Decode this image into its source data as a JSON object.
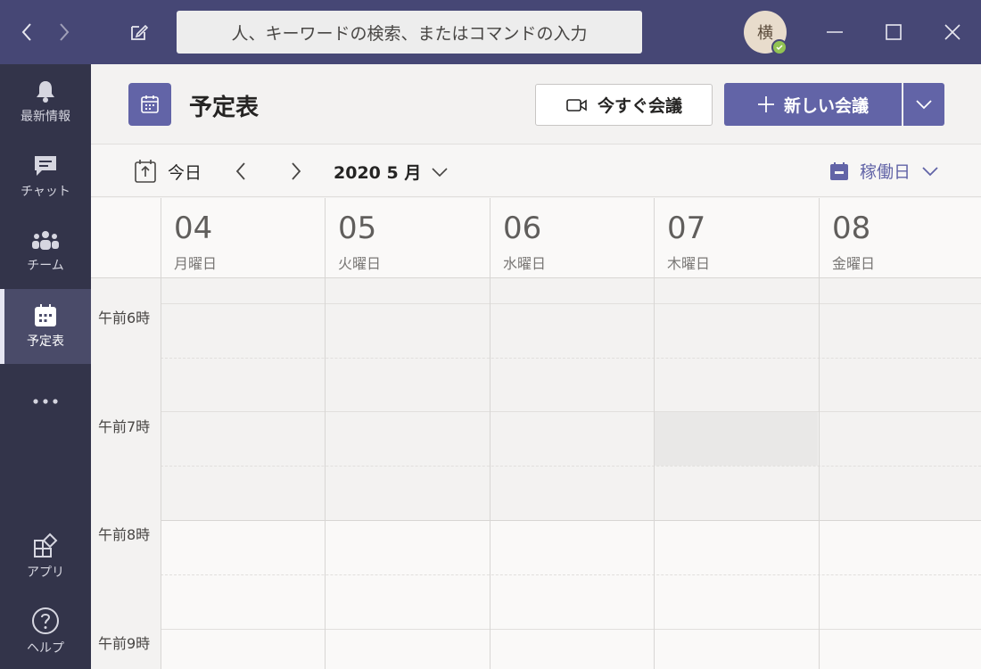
{
  "titlebar": {
    "search_placeholder": "人、キーワードの検索、またはコマンドの入力",
    "avatar_initial": "横",
    "bg_color": "#464775"
  },
  "rail": {
    "items": [
      {
        "label": "最新情報",
        "icon": "bell-icon"
      },
      {
        "label": "チャット",
        "icon": "chat-icon"
      },
      {
        "label": "チーム",
        "icon": "teams-icon"
      },
      {
        "label": "予定表",
        "icon": "calendar-icon",
        "active": true
      },
      {
        "label": "",
        "icon": "more-icon"
      },
      {
        "label": "アプリ",
        "icon": "apps-icon"
      },
      {
        "label": "ヘルプ",
        "icon": "help-icon"
      }
    ]
  },
  "header": {
    "title": "予定表",
    "meet_now_label": "今すぐ会議",
    "new_meeting_label": "新しい会議",
    "accent_color": "#6264a7"
  },
  "toolbar": {
    "today_label": "今日",
    "month_label": "2020 5 月",
    "view_label": "稼働日"
  },
  "days": [
    {
      "num": "04",
      "name": "月曜日"
    },
    {
      "num": "05",
      "name": "火曜日"
    },
    {
      "num": "06",
      "name": "水曜日"
    },
    {
      "num": "07",
      "name": "木曜日"
    },
    {
      "num": "08",
      "name": "金曜日"
    }
  ],
  "times": [
    "午前6時",
    "午前7時",
    "午前8時",
    "午前9時"
  ]
}
